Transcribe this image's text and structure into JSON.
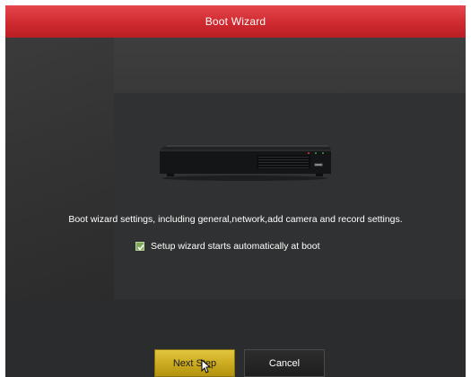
{
  "window": {
    "title": "Boot Wizard"
  },
  "main": {
    "description": "Boot wizard settings, including general,network,add camera and record settings.",
    "autostart": {
      "label": "Setup wizard starts automatically at boot",
      "checked": true
    }
  },
  "footer": {
    "next_label": "Next Step",
    "cancel_label": "Cancel"
  },
  "colors": {
    "title_bar": "#cf2a30",
    "primary_button": "#caa91f",
    "checkbox": "#7fa95a"
  },
  "icons": {
    "checkbox": "checkmark-icon",
    "device": "nvr-device-icon",
    "cursor": "mouse-pointer-icon"
  }
}
